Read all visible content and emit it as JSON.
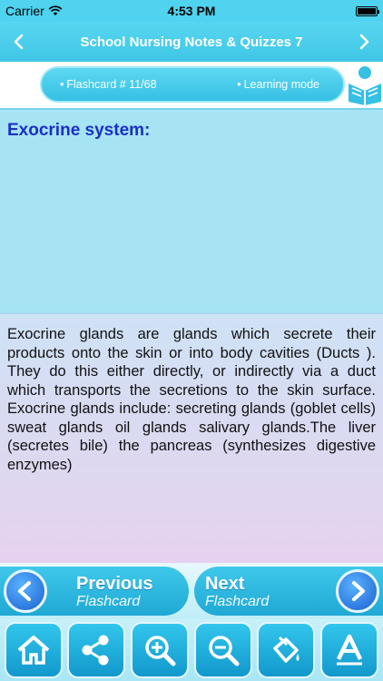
{
  "status_bar": {
    "carrier": "Carrier",
    "time": "4:53 PM",
    "battery_level": 1.0
  },
  "nav": {
    "title": "School Nursing Notes & Quizzes 7",
    "back_icon": "chevron-left-icon",
    "forward_icon": "chevron-right-icon"
  },
  "info": {
    "flashcard": "Flashcard #  11/68",
    "mode": "Learning mode"
  },
  "question": {
    "text": "Exocrine system:"
  },
  "answer": {
    "text": "Exocrine glands are glands which secrete their products onto the skin or into body cavities (Ducts ). They do this either directly, or indirectly via a duct which transports the secretions to the skin surface. Exocrine glands include: secreting glands (goblet cells) sweat glands oil glands salivary glands.The liver (secretes bile) the pancreas (synthesizes digestive enzymes)"
  },
  "pager": {
    "prev_label": "Previous",
    "prev_sub": "Flashcard",
    "next_label": "Next",
    "next_sub": "Flashcard"
  },
  "toolbar": {
    "tools": [
      "home-icon",
      "share-icon",
      "zoom-in-icon",
      "zoom-out-icon",
      "paint-bucket-icon",
      "font-icon"
    ]
  },
  "colors": {
    "accent": "#3fc6e6",
    "question_text": "#1a2fc4"
  }
}
